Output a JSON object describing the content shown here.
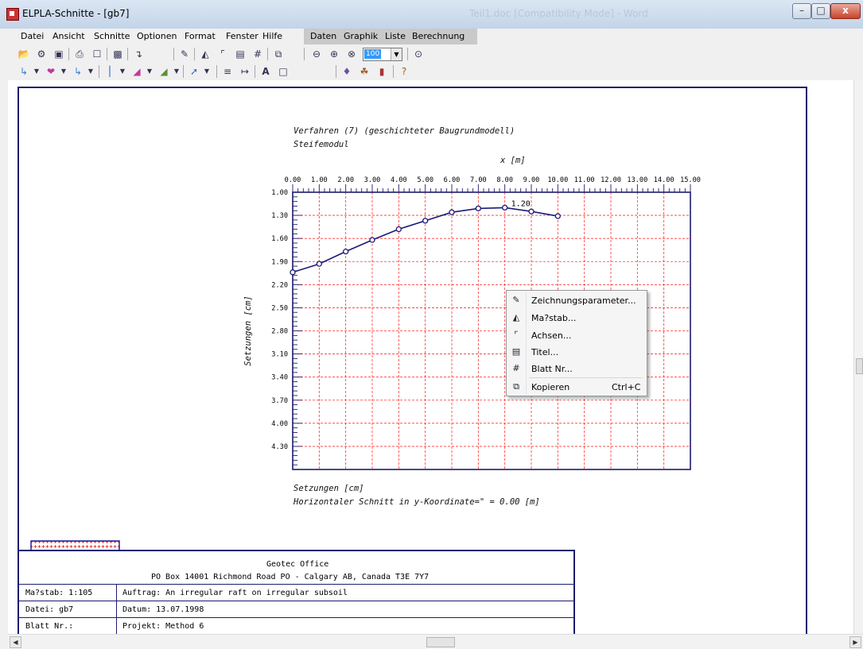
{
  "window": {
    "title": "ELPLA-Schnitte - [gb7]",
    "ghost_title": "Teil1.doc [Compatibility Mode] - Word",
    "minimize": "–",
    "maximize": "□",
    "close": "x"
  },
  "menu": {
    "items": [
      "Datei",
      "Ansicht",
      "Schnitte",
      "Optionen",
      "Format",
      "Fenster",
      "Hilfe"
    ],
    "extra": [
      "Daten",
      "Graphik",
      "Liste",
      "Berechnung"
    ]
  },
  "toolbar": {
    "zoom_value": "100"
  },
  "plot": {
    "title_line1": "Verfahren (7) (geschichteter Baugrundmodell)",
    "title_line2": "Steifemodul",
    "x_axis_label": "x [m]",
    "y_axis_label": "Setzungen [cm]",
    "bottom_line1": "Setzungen [cm]",
    "bottom_line2": "Horizontaler Schnitt in y-Koordinate=\" = 0.00 [m]",
    "x_ticks": [
      "0.00",
      "1.00",
      "2.00",
      "3.00",
      "4.00",
      "5.00",
      "6.00",
      "7.00",
      "8.00",
      "9.00",
      "10.00",
      "11.00",
      "12.00",
      "13.00",
      "14.00",
      "15.00"
    ],
    "y_ticks": [
      "1.00",
      "1.30",
      "1.60",
      "1.90",
      "2.20",
      "2.50",
      "2.80",
      "3.10",
      "3.40",
      "3.70",
      "4.00",
      "4.30"
    ],
    "max_label": "1.20"
  },
  "chart_data": {
    "type": "line",
    "title": "Verfahren (7) (geschichteter Baugrundmodell)",
    "subtitle": "Steifemodul",
    "xlabel": "x [m]",
    "ylabel": "Setzungen [cm]",
    "xlim": [
      0,
      15
    ],
    "ylim": [
      4.6,
      1.0
    ],
    "y_inverted": true,
    "grid": true,
    "series": [
      {
        "x": [
          0,
          1,
          2,
          3,
          4,
          5,
          6,
          7,
          8,
          9,
          10
        ],
        "values": [
          2.04,
          1.93,
          1.77,
          1.62,
          1.48,
          1.37,
          1.26,
          1.21,
          1.2,
          1.25,
          1.31
        ]
      }
    ],
    "annotations": [
      {
        "x": 8.0,
        "y": 1.2,
        "text": "1.20"
      }
    ]
  },
  "context_menu": {
    "items": [
      {
        "label": "Zeichnungsparameter...",
        "icon": "drawing-params-icon",
        "shortcut": ""
      },
      {
        "label": "Ma?stab...",
        "icon": "scale-icon",
        "shortcut": ""
      },
      {
        "label": "Achsen...",
        "icon": "axes-icon",
        "shortcut": ""
      },
      {
        "label": "Titel...",
        "icon": "title-icon",
        "shortcut": ""
      },
      {
        "label": "Blatt Nr...",
        "icon": "sheet-number-icon",
        "shortcut": ""
      },
      {
        "label": "Kopieren",
        "icon": "copy-icon",
        "shortcut": "Ctrl+C"
      }
    ]
  },
  "title_block": {
    "company": "Geotec Office",
    "address": "PO Box 14001 Richmond Road PO - Calgary AB, Canada T3E 7Y7",
    "scale": "Ma?stab: 1:105",
    "file": "Datei: gb7",
    "sheet": "Blatt Nr.:",
    "project_order": "Auftrag: An irregular raft on irregular subsoil",
    "date": "Datum: 13.07.1998",
    "project": "Projekt: Method 6"
  },
  "colors": {
    "accent": "#1c1c6e",
    "grid": "#ff3030",
    "curve": "#1a1a7a"
  }
}
